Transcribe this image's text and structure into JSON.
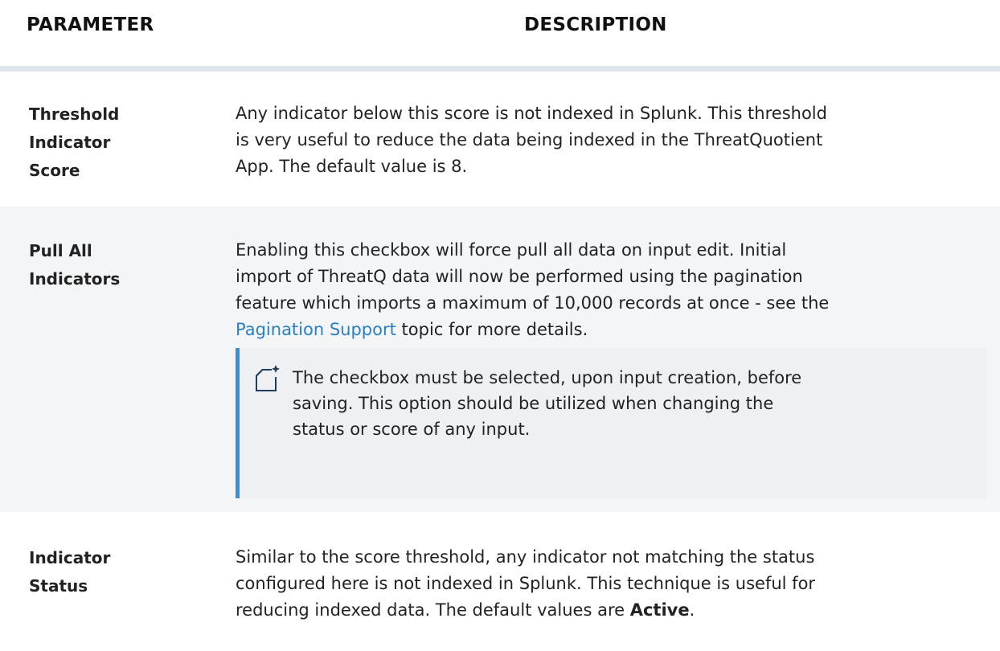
{
  "header": {
    "parameter": "PARAMETER",
    "description": "DESCRIPTION"
  },
  "rows": [
    {
      "param_lines": [
        "Threshold",
        "Indicator",
        "Score"
      ],
      "description_lines": [
        "Any indicator below this score is not indexed in Splunk. This threshold",
        "is very useful to reduce the data being indexed in the ThreatQuotient",
        "App. The default value is 8."
      ]
    },
    {
      "param_lines": [
        "Pull All",
        "Indicators"
      ],
      "description_lines": [
        "Enabling this checkbox will force pull all data on input edit.  Initial",
        "import of ThreatQ data will now be performed using the pagination",
        "feature which imports a maximum of 10,000 records at once - see the"
      ],
      "link_text": "Pagination Support",
      "link_suffix": " topic for more details.",
      "note": {
        "icon": "note-icon",
        "lines": [
          "The checkbox must be selected, upon input creation, before",
          "saving. This option should be utilized when changing the",
          "status or score of any input."
        ]
      }
    },
    {
      "param_lines": [
        "Indicator",
        "Status"
      ],
      "description_lines": [
        "Similar to the score threshold, any indicator not matching the status",
        "configured here is not indexed in Splunk.  This technique is useful for"
      ],
      "last_line_prefix": "reducing indexed data. The default values are  ",
      "last_line_bold": "Active",
      "last_line_suffix": "."
    }
  ],
  "colors": {
    "link": "#2b80c5",
    "note_border": "#3a8dd6",
    "header_rule": "#dfe5ec",
    "shaded_row": "#f4f5f7"
  }
}
